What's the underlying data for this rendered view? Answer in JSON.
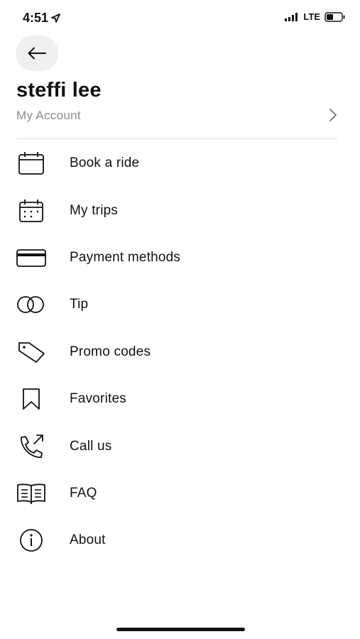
{
  "status_bar": {
    "time": "4:51",
    "network": "LTE"
  },
  "header": {
    "back_icon": "arrow-left-icon"
  },
  "profile": {
    "name": "steffi lee",
    "account_label": "My Account"
  },
  "menu": [
    {
      "label": "Book a ride",
      "icon": "calendar-icon"
    },
    {
      "label": "My trips",
      "icon": "calendar-dots-icon"
    },
    {
      "label": "Payment methods",
      "icon": "credit-card-icon"
    },
    {
      "label": "Tip",
      "icon": "coins-icon"
    },
    {
      "label": "Promo codes",
      "icon": "tag-icon"
    },
    {
      "label": "Favorites",
      "icon": "bookmark-icon"
    },
    {
      "label": "Call us",
      "icon": "phone-outgoing-icon"
    },
    {
      "label": "FAQ",
      "icon": "book-open-icon"
    },
    {
      "label": "About",
      "icon": "info-icon"
    }
  ],
  "colors": {
    "background": "#ffffff",
    "text": "#111111",
    "secondary_text": "#8a8a8a",
    "back_button_bg": "#efeff1",
    "divider": "#d8d8d8"
  }
}
